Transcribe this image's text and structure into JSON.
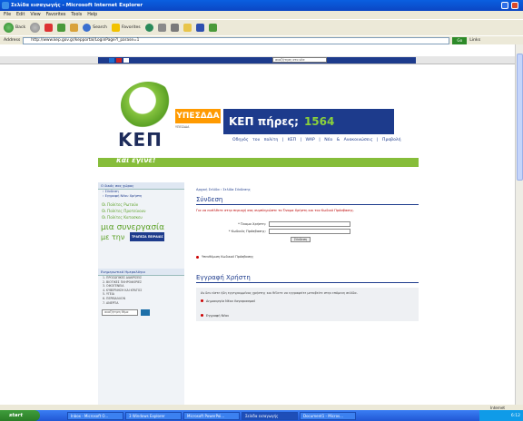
{
  "window": {
    "title": "Σελίδα εισαγωγής - Microsoft Internet Explorer"
  },
  "menu": [
    "File",
    "Edit",
    "View",
    "Favorites",
    "Tools",
    "Help"
  ],
  "toolbar": {
    "back": "Back",
    "search": "Search",
    "favorites": "Favorites"
  },
  "address": {
    "label": "Address",
    "url": "http://www.kep.gov.gr/kepportal/LoginPage?l_parase=1",
    "go": "Go",
    "links": "Links"
  },
  "site": {
    "search_placeholder": "αναζήτηση στο site",
    "ypes": "ΥΠΕΣΔΔΑ",
    "ypes_sub": "ΥΠΕΣΔΔΑ",
    "banner_title": "ΚΕΠ πήρες;",
    "banner_number": "1564",
    "kep": "ΚΕΠ",
    "slogan": "και έγινε!",
    "topnav": "Οδηγός του πολίτη | ΚΕΠ | WAP | Νέα & Ανακοινώσεις | Προβολή"
  },
  "sidebar": {
    "head1": "Ο δικός σας χώρος",
    "links": [
      "› Σύνδεση",
      "› Εγγραφή Νέου Χρήστη"
    ],
    "green": [
      "Οι Πολίτες Ρωτούν",
      "Οι Πολίτες Προτείνουν",
      "Οι Πολίτες Κατασκευ"
    ],
    "big1": "μια συνεργασία",
    "big2": "με την",
    "bank": "ΤΡΑΠΕΖΑ ΠΕΙΡΑΙΩΣ",
    "list_head": "Ενημερωτικό Ημερολόγιο",
    "list": [
      "1. ΠΡΟΣΩΠΙΚΕΣ ΔΙΑΚΡΙΣΕΙΣ",
      "2. ΒΙΟΤΙΚΕΣ ΠΛΗΡΟΦΟΡΙΕΣ",
      "3. ΟΙΚΟΓΕΝΕΙΑ",
      "4. ΚΥΒΕΡΝΗΣΗ ΚΑΙ ΚΡΑΤΟΣ",
      "5. ΥΓΕΙΑ",
      "6. ΠΕΡΙΒΑΛΛΟΝ",
      "7. ΑΝΕΡΓΙΑ"
    ],
    "search_placeholder": "αναζήτηση θέμα"
  },
  "main": {
    "crumb": "Αρχική Σελίδα › Σελίδα Σύνδεσης",
    "login_title": "Σύνδεση",
    "login_note": "Για να εισέλθετε στην περιοχή σας συμπληρώστε το Όνομα Χρήστη και τον Κωδικό Πρόσβασης.",
    "username_label": "* Όνομα Χρήστη:",
    "password_label": "* Κωδικός Πρόσβασης:",
    "login_button": "Σύνδεση",
    "forgot": "Υπενθύμιση Κωδικού Πρόσβασης",
    "register_title": "Εγγραφή Χρήστη",
    "register_text": "Αν δεν είστε ήδη εγγεγραμμένος χρήστης και θέλετε να εγγραφείτε μεταβείτε στην επόμενη σελίδα.",
    "register_link": "Δημιουργία Νέου Λογαριασμού",
    "new_link": "Εγγραφή Νέου"
  },
  "statusbar": {
    "zone": "Internet"
  },
  "taskbar": {
    "start": "start",
    "tasks": [
      "Inbox - Microsoft O...",
      "3 Windows Explorer",
      "Microsoft PowerPoi...",
      "Σελίδα εισαγωγής",
      "Document1 - Micros..."
    ],
    "time": "6:12"
  }
}
